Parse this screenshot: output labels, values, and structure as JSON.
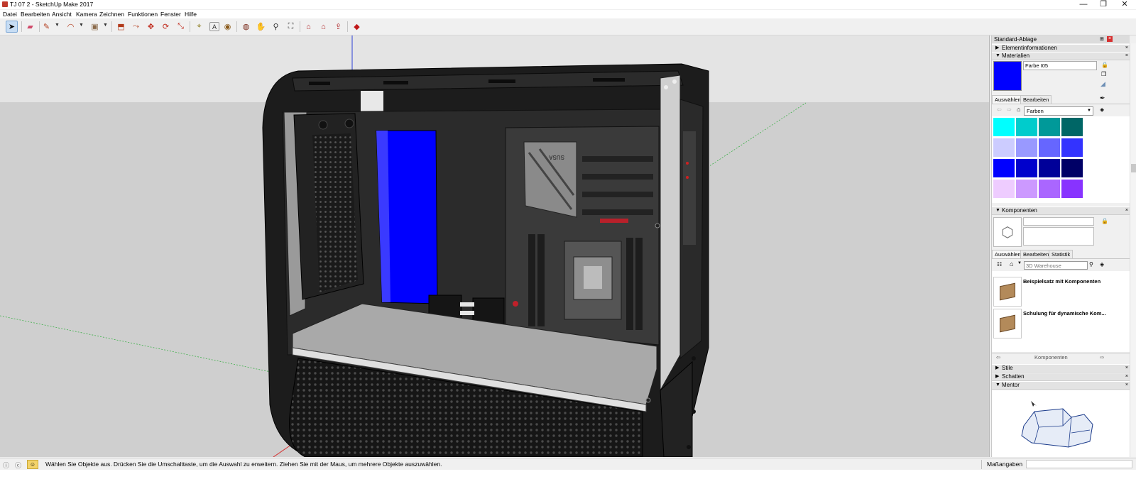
{
  "window": {
    "title": "TJ 07 2 - SketchUp Make 2017",
    "minimize_glyph": "—",
    "restore_glyph": "❐",
    "close_glyph": "✕"
  },
  "menu": [
    "Datei",
    "Bearbeiten",
    "Ansicht",
    "Kamera",
    "Zeichnen",
    "Funktionen",
    "Fenster",
    "Hilfe"
  ],
  "toolbar": {
    "tools": [
      {
        "icon": "select-arrow-icon",
        "glyph": "➤"
      },
      {
        "icon": "eraser-icon",
        "glyph": "▰"
      },
      {
        "icon": "pencil-line-icon",
        "glyph": "✎"
      },
      {
        "icon": "arc-icon",
        "glyph": "◠"
      },
      {
        "icon": "rectangle-icon",
        "glyph": "▣"
      },
      {
        "icon": "push-pull-icon",
        "glyph": "⬒"
      },
      {
        "icon": "follow-me-icon",
        "glyph": "⤳"
      },
      {
        "icon": "move-icon",
        "glyph": "✥"
      },
      {
        "icon": "rotate-icon",
        "glyph": "⟳"
      },
      {
        "icon": "scale-icon",
        "glyph": "⤡"
      },
      {
        "icon": "tape-measure-icon",
        "glyph": "⌖"
      },
      {
        "icon": "text-icon",
        "glyph": "A"
      },
      {
        "icon": "paint-bucket-icon",
        "glyph": "◉"
      },
      {
        "icon": "orbit-icon",
        "glyph": "◍"
      },
      {
        "icon": "pan-icon",
        "glyph": "✋"
      },
      {
        "icon": "zoom-icon",
        "glyph": "⚲"
      },
      {
        "icon": "zoom-extents-icon",
        "glyph": "⛶"
      },
      {
        "icon": "warehouse-icon",
        "glyph": "⌂"
      },
      {
        "icon": "extension-warehouse-icon",
        "glyph": "⌂"
      },
      {
        "icon": "share-model-icon",
        "glyph": "⇪"
      },
      {
        "icon": "ruby-extension-icon",
        "glyph": "◆"
      }
    ]
  },
  "tray": {
    "title": "Standard-Ablage",
    "entity_info_label": "Elementinformationen",
    "materials": {
      "header": "Materialien",
      "material_name": "Farbe I05",
      "preview_color": "#0000ff",
      "tabs": [
        "Auswählen",
        "Bearbeiten"
      ],
      "library": "Farben",
      "swatches": [
        "#00ffff",
        "#00cccc",
        "#009999",
        "#006666",
        "#ccccff",
        "#9999ff",
        "#6666ff",
        "#3333ff",
        "#0000ff",
        "#0000cc",
        "#000099",
        "#000066",
        "#eeccff",
        "#cc99ff",
        "#aa66ff",
        "#8833ff"
      ]
    },
    "components": {
      "header": "Komponenten",
      "tabs": [
        "Auswählen",
        "Bearbeiten",
        "Statistik"
      ],
      "search_placeholder": "3D Warehouse",
      "items": [
        "Beispielsatz mit Komponenten",
        "Schulung für dynamische Kom..."
      ],
      "footer_label": "Komponenten"
    },
    "styles_label": "Stile",
    "shadows_label": "Schatten",
    "mentor_label": "Mentor"
  },
  "status": {
    "message": "Wählen Sie Objekte aus. Drücken Sie die Umschalttaste, um die Auswahl zu erweitern. Ziehen Sie mit der Maus, um mehrere Objekte auszuwählen.",
    "measurements_label": "Maßangaben"
  }
}
